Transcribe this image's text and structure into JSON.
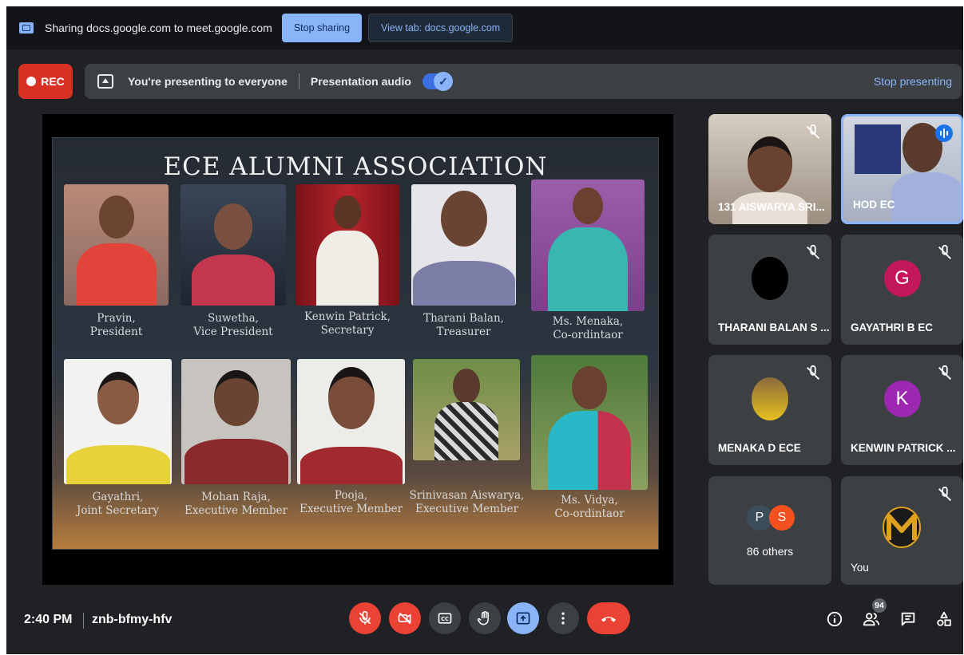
{
  "share_bar": {
    "text": "Sharing docs.google.com to meet.google.com",
    "stop_sharing": "Stop sharing",
    "view_tab": "View tab: docs.google.com"
  },
  "presenting_bar": {
    "rec_label": "REC",
    "presenting_text": "You're presenting to everyone",
    "audio_label": "Presentation audio",
    "audio_enabled": true,
    "stop_presenting": "Stop presenting"
  },
  "slide": {
    "title": "ECE ALUMNI ASSOCIATION",
    "members": [
      {
        "name": "Pravin,",
        "role": "President"
      },
      {
        "name": "Suwetha,",
        "role": "Vice President"
      },
      {
        "name": "Kenwin Patrick,",
        "role": "Secretary"
      },
      {
        "name": "Tharani Balan,",
        "role": "Treasurer"
      },
      {
        "name": "Ms. Menaka,",
        "role": "Co-ordintaor"
      },
      {
        "name": "Gayathri,",
        "role": "Joint Secretary"
      },
      {
        "name": "Mohan Raja,",
        "role": "Executive Member"
      },
      {
        "name": "Pooja,",
        "role": "Executive Member"
      },
      {
        "name": "Srinivasan Aiswarya,",
        "role": "Executive Member"
      },
      {
        "name": "Ms. Vidya,",
        "role": "Co-ordintaor"
      }
    ]
  },
  "participants": [
    {
      "name": "131 AISWARYA SRI...",
      "muted": true,
      "video": true
    },
    {
      "name": "HOD EC",
      "muted": false,
      "speaking": true,
      "video": true
    },
    {
      "name": "THARANI BALAN S ...",
      "muted": true
    },
    {
      "name": "GAYATHRI B EC",
      "muted": true,
      "initial": "G",
      "color": "#c2185b"
    },
    {
      "name": "MENAKA D ECE",
      "muted": true
    },
    {
      "name": "KENWIN PATRICK ...",
      "muted": true,
      "initial": "K",
      "color": "#9c27b0"
    },
    {
      "name": "86 others",
      "initials": [
        "P",
        "S"
      ],
      "colors": [
        "#3c4d5c",
        "#f4511e"
      ]
    },
    {
      "name": "You",
      "muted": true
    }
  ],
  "bottom_bar": {
    "time": "2:40 PM",
    "meeting_code": "znb-bfmy-hfv",
    "people_count": "94"
  },
  "colors": {
    "accent_blue": "#8ab4f8",
    "danger_red": "#ea4335",
    "surface": "#3c4043",
    "background": "#202124"
  }
}
